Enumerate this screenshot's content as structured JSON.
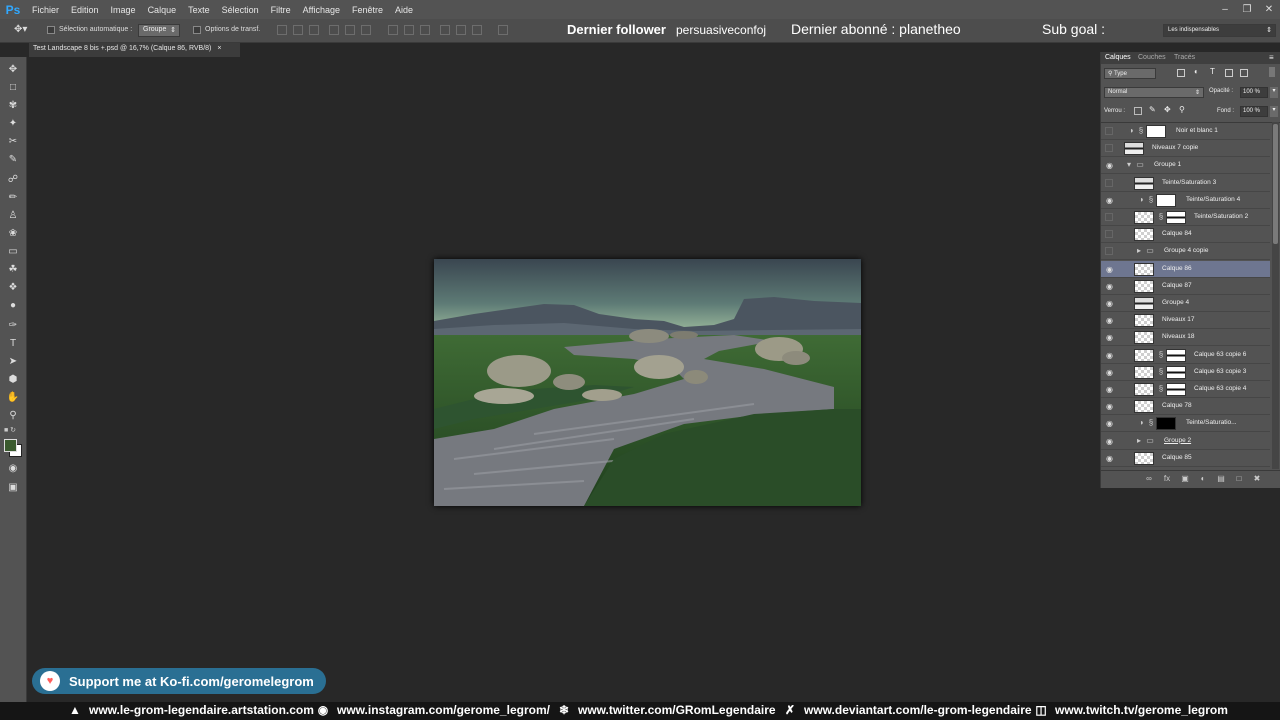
{
  "menubar": {
    "logo": "Ps",
    "items": [
      "Fichier",
      "Edition",
      "Image",
      "Calque",
      "Texte",
      "Sélection",
      "Filtre",
      "Affichage",
      "Fenêtre",
      "Aide"
    ]
  },
  "options_bar": {
    "auto_select_label": "Sélection automatique :",
    "auto_select_value": "Groupe",
    "transform_label": "Options de transf.",
    "workspace": "Les indispensables"
  },
  "stream": {
    "follower_label": "Dernier follower",
    "follower_name": "persuasiveconfoj",
    "subscriber": "Dernier abonné : planetheo",
    "sub_goal": "Sub goal :"
  },
  "document_tab": {
    "title": "Test Landscape 8 bis +.psd @ 16,7% (Calque 86, RVB/8)",
    "close": "×"
  },
  "layers_panel": {
    "tabs": [
      "Calques",
      "Couches",
      "Tracés"
    ],
    "filter_kind": "Type",
    "blend_mode": "Normal",
    "opacity_label": "Opacité :",
    "opacity_value": "100 %",
    "lock_label": "Verrou :",
    "fill_label": "Fond :",
    "fill_value": "100 %",
    "layers": [
      {
        "name": "Noir et blanc 1",
        "visible": false,
        "type": "adjustment"
      },
      {
        "name": "Niveaux 7 copie",
        "visible": false,
        "type": "image"
      },
      {
        "name": "Groupe 1",
        "visible": true,
        "type": "group-open"
      },
      {
        "name": "Teinte/Saturation 3",
        "visible": false,
        "type": "image"
      },
      {
        "name": "Teinte/Saturation 4",
        "visible": true,
        "type": "adjustment"
      },
      {
        "name": "Teinte/Saturation 2",
        "visible": false,
        "type": "masked"
      },
      {
        "name": "Calque 84",
        "visible": false,
        "type": "pixel"
      },
      {
        "name": "Groupe 4 copie",
        "visible": false,
        "type": "group"
      },
      {
        "name": "Calque 86",
        "visible": true,
        "type": "pixel",
        "selected": true
      },
      {
        "name": "Calque 87",
        "visible": true,
        "type": "pixel"
      },
      {
        "name": "Groupe 4",
        "visible": true,
        "type": "image"
      },
      {
        "name": "Niveaux 17",
        "visible": true,
        "type": "pixel"
      },
      {
        "name": "Niveaux 18",
        "visible": true,
        "type": "pixel"
      },
      {
        "name": "Calque 63 copie 6",
        "visible": true,
        "type": "masked"
      },
      {
        "name": "Calque 63 copie 3",
        "visible": true,
        "type": "masked"
      },
      {
        "name": "Calque 63 copie 4",
        "visible": true,
        "type": "masked"
      },
      {
        "name": "Calque 78",
        "visible": true,
        "type": "pixel"
      },
      {
        "name": "Teinte/Saturatio...",
        "visible": true,
        "type": "adjustment-black"
      },
      {
        "name": "Groupe 2",
        "visible": true,
        "type": "group"
      },
      {
        "name": "Calque 85",
        "visible": true,
        "type": "pixel"
      }
    ]
  },
  "overlay": {
    "kofi": "Support me at Ko-fi.com/geromelegrom",
    "links": [
      {
        "icon": "artstation-icon",
        "text": "www.le-grom-legendaire.artstation.com"
      },
      {
        "icon": "instagram-icon",
        "text": "www.instagram.com/gerome_legrom/"
      },
      {
        "icon": "twitter-icon",
        "text": "www.twitter.com/GRomLegendaire"
      },
      {
        "icon": "deviantart-icon",
        "text": "www.deviantart.com/le-grom-legendaire"
      },
      {
        "icon": "twitch-icon",
        "text": "www.twitch.tv/gerome_legrom"
      }
    ]
  }
}
